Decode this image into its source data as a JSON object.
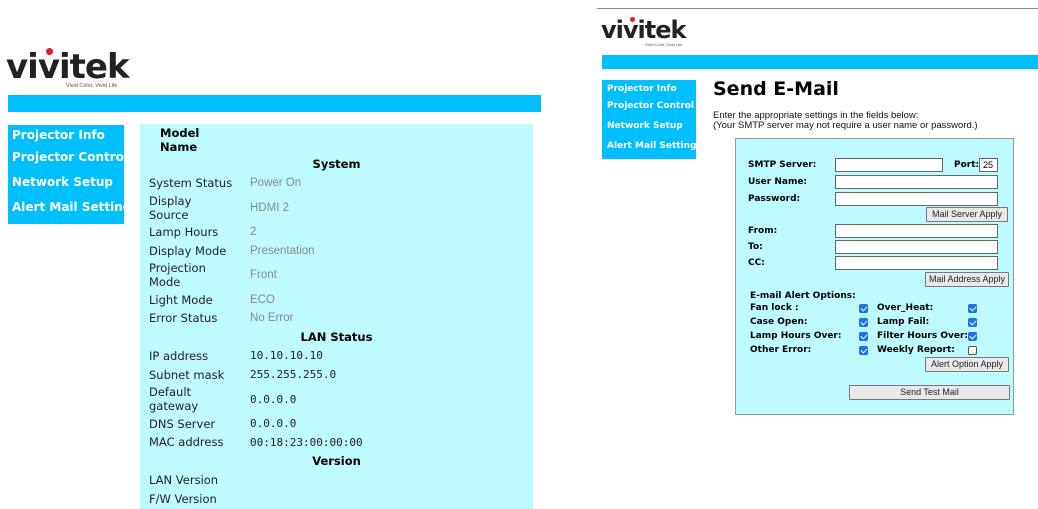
{
  "brand": {
    "name": "vivitek",
    "tagline": "Vivid Color, Vivid Life"
  },
  "colors": {
    "accent": "#00bfff",
    "table_bg": "#bdfbff",
    "checkbox_on": "#1a73e8",
    "logo_dot": "#e31e24"
  },
  "nav": [
    {
      "label": "Projector Info"
    },
    {
      "label": "Projector Control"
    },
    {
      "label": "Network Setup"
    },
    {
      "label": "Alert Mail Settings"
    }
  ],
  "info": {
    "model_name_label": "Model Name",
    "model_name_value": "",
    "system_header": "System",
    "system": [
      {
        "label": "System Status",
        "value": "Power On"
      },
      {
        "label": "Display Source",
        "value": "HDMI 2"
      },
      {
        "label": "Lamp Hours",
        "value": "2"
      },
      {
        "label": "Display Mode",
        "value": "Presentation"
      },
      {
        "label": "Projection Mode",
        "value": "Front"
      },
      {
        "label": "Light Mode",
        "value": "ECO"
      },
      {
        "label": "Error Status",
        "value": "No Error"
      }
    ],
    "lan_header": "LAN Status",
    "lan": [
      {
        "label": "IP address",
        "value": "10.10.10.10"
      },
      {
        "label": "Subnet mask",
        "value": "255.255.255.0"
      },
      {
        "label": "Default gateway",
        "value": "0.0.0.0"
      },
      {
        "label": "DNS Server",
        "value": "0.0.0.0"
      },
      {
        "label": "MAC address",
        "value": "00:18:23:00:00:00"
      }
    ],
    "version_header": "Version",
    "version": [
      {
        "label": "LAN Version",
        "value": ""
      },
      {
        "label": "F/W Version",
        "value": ""
      }
    ]
  },
  "email": {
    "title": "Send E-Mail",
    "intro_line1": "Enter the appropriate settings in the fields below:",
    "intro_line2": "(Your SMTP server may not require a user name or password.)",
    "smtp_label": "SMTP Server:",
    "smtp_value": "",
    "port_label": "Port:",
    "port_value": "25",
    "username_label": "User Name:",
    "username_value": "",
    "password_label": "Password:",
    "password_value": "",
    "mail_server_apply": "Mail Server Apply",
    "from_label": "From:",
    "from_value": "",
    "to_label": "To:",
    "to_value": "",
    "cc_label": "CC:",
    "cc_value": "",
    "mail_address_apply": "Mail Address Apply",
    "options_label": "E-mail Alert Options:",
    "options": {
      "fan_lock": {
        "label": "Fan lock :",
        "checked": true
      },
      "over_heat": {
        "label": "Over_Heat:",
        "checked": true
      },
      "case_open": {
        "label": "Case Open:",
        "checked": true
      },
      "lamp_fail": {
        "label": "Lamp Fail:",
        "checked": true
      },
      "lamp_hours_over": {
        "label": "Lamp Hours Over:",
        "checked": true
      },
      "filter_hours_over": {
        "label": "Filter Hours Over:",
        "checked": true
      },
      "other_error": {
        "label": "Other Error:",
        "checked": true
      },
      "weekly_report": {
        "label": "Weekly Report:",
        "checked": false
      }
    },
    "alert_option_apply": "Alert Option Apply",
    "send_test_mail": "Send Test Mail"
  }
}
